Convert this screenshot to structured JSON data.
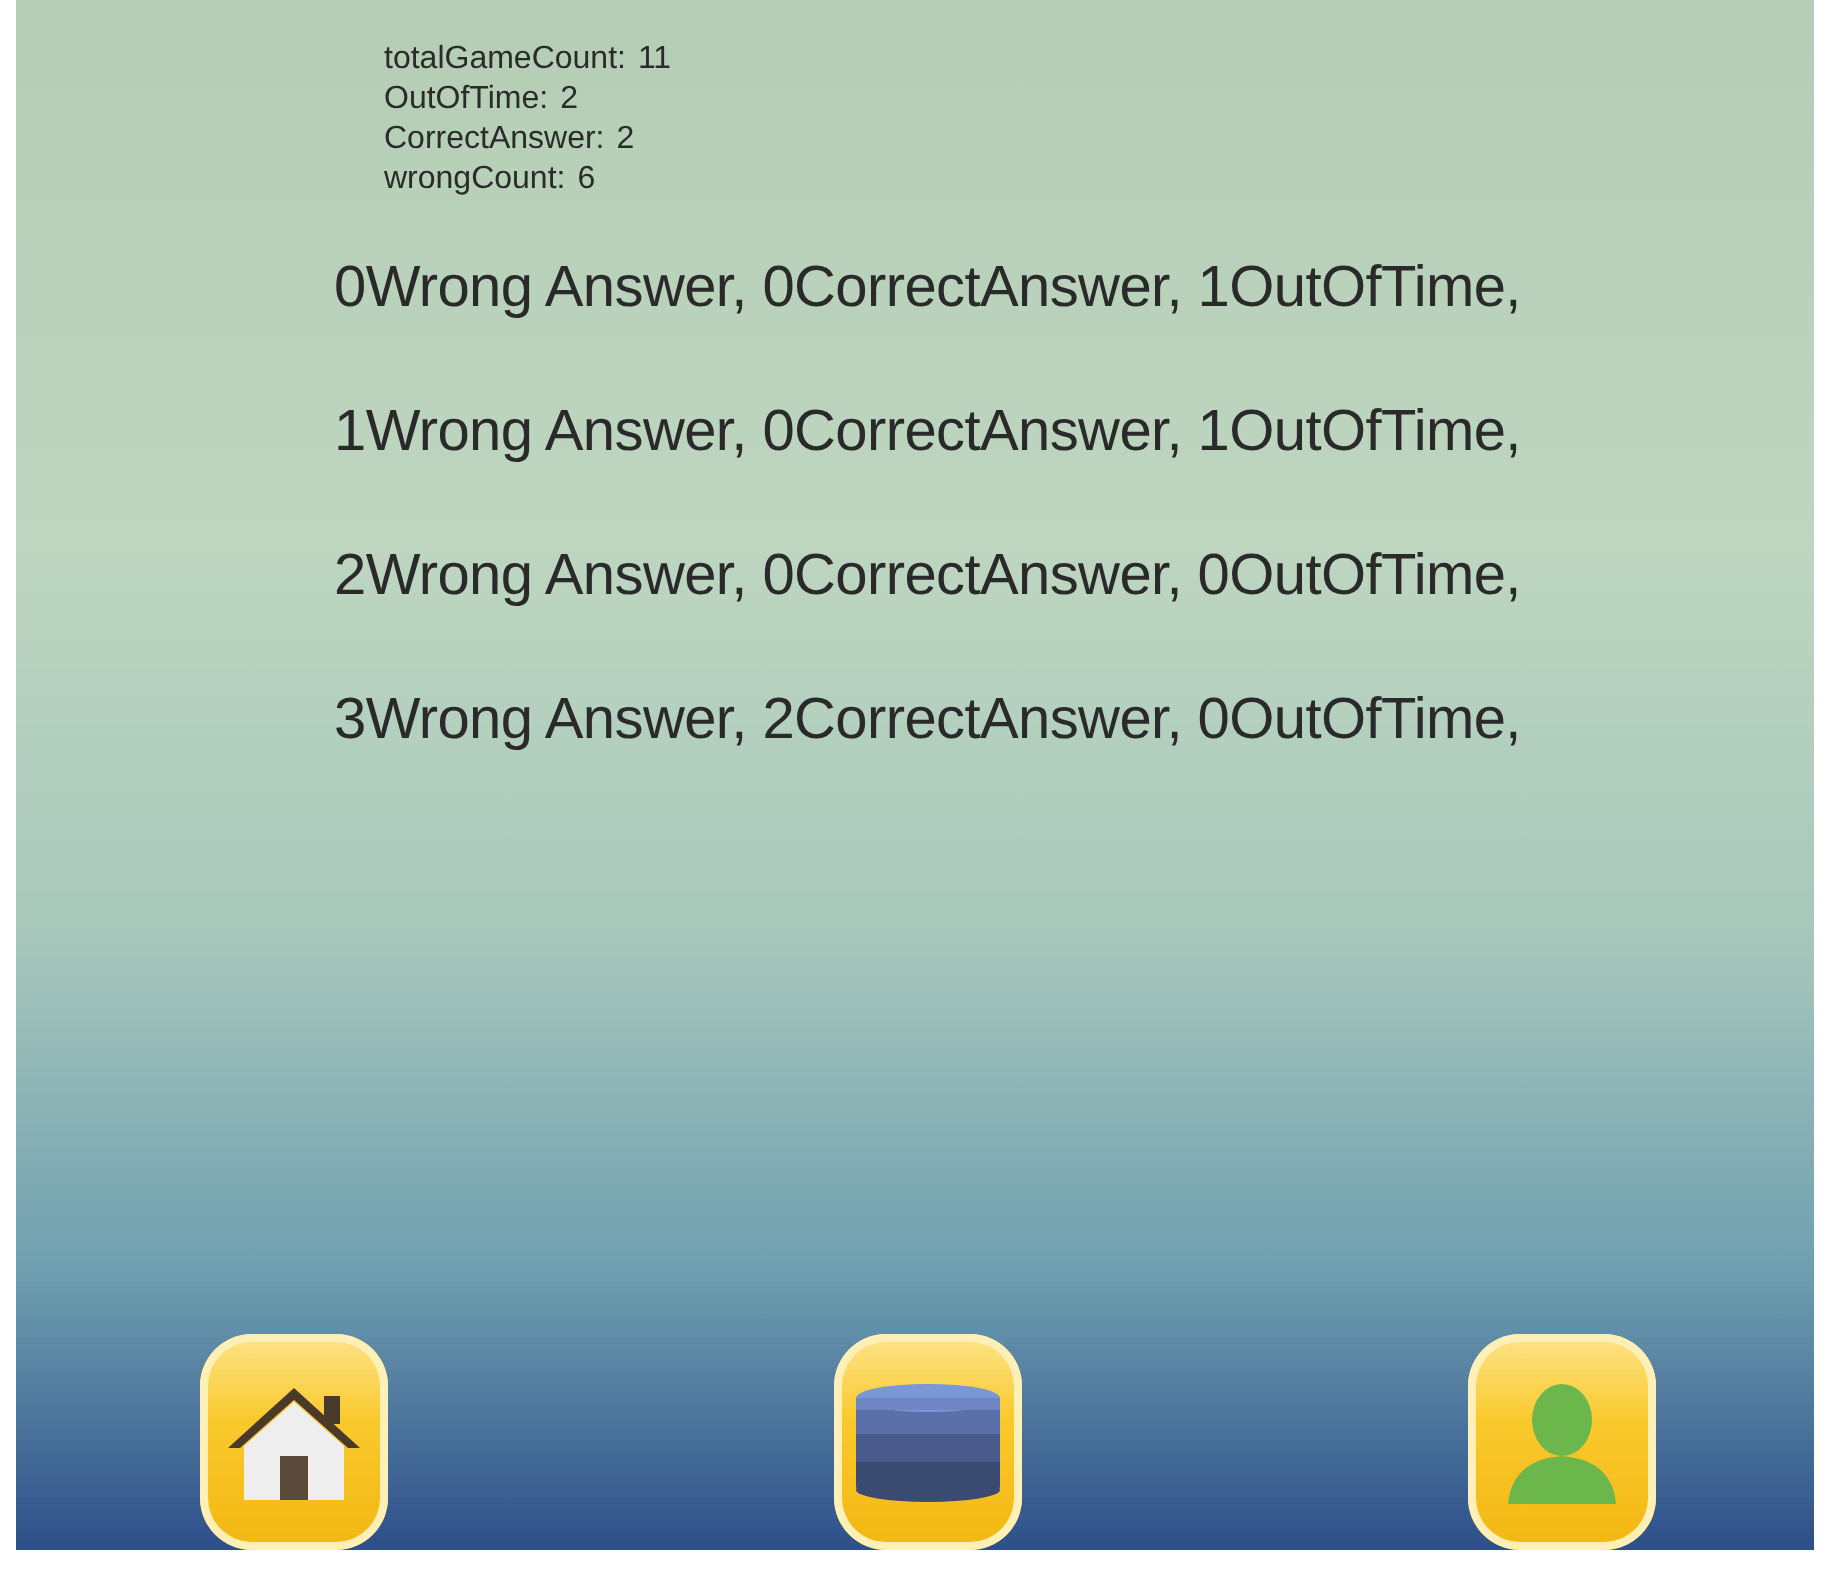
{
  "stats": [
    {
      "label": "totalGameCount:",
      "value": "11"
    },
    {
      "label": "OutOfTime:",
      "value": "2"
    },
    {
      "label": "CorrectAnswer:",
      "value": "2"
    },
    {
      "label": "wrongCount:",
      "value": "6"
    }
  ],
  "entries": [
    "0Wrong Answer, 0CorrectAnswer, 1OutOfTime,",
    "1Wrong Answer, 0CorrectAnswer, 1OutOfTime,",
    "2Wrong Answer, 0CorrectAnswer, 0OutOfTime,",
    "3Wrong Answer, 2CorrectAnswer, 0OutOfTime,"
  ],
  "nav_buttons": [
    {
      "kind": "home"
    },
    {
      "kind": "database"
    },
    {
      "kind": "profile"
    }
  ]
}
